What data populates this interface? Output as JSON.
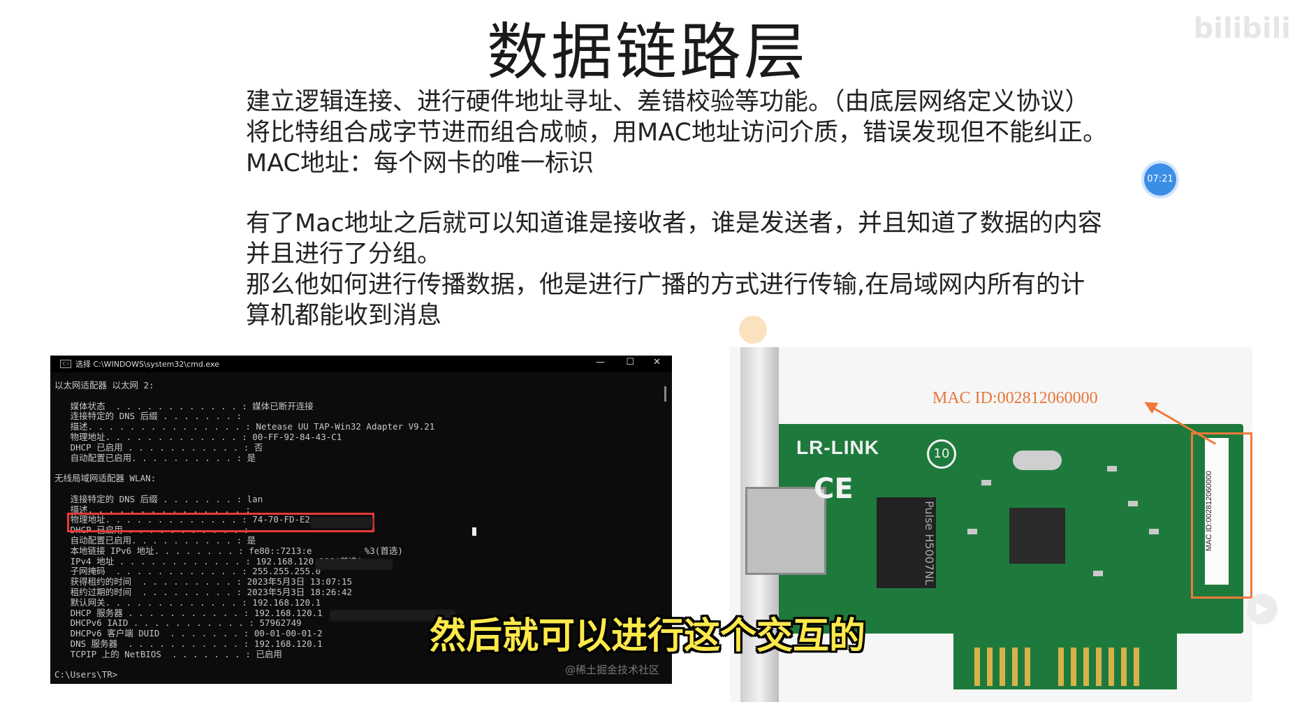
{
  "slide": {
    "title": "数据链路层",
    "paragraphs": [
      "建立逻辑连接、进行硬件地址寻址、差错校验等功能。（由底层网络定义协议）",
      "将比特组合成字节进而组合成帧，用MAC地址访问介质，错误发现但不能纠正。",
      "MAC地址：每个网卡的唯一标识",
      "有了Mac地址之后就可以知道谁是接收者，谁是发送者，并且知道了数据的内容",
      "并且进行了分组。",
      "那么他如何进行传播数据，他是进行广播的方式进行传输,在局域网内所有的计",
      "算机都能收到消息"
    ]
  },
  "video": {
    "timestamp": "07:21",
    "subtitle": "然后就可以进行这个交互的",
    "watermark_top": "bilibili"
  },
  "cmd": {
    "title": "选择 C:\\WINDOWS\\system32\\cmd.exe",
    "icon_text": "C:\\",
    "minimize": "—",
    "maximize": "☐",
    "close": "✕",
    "lines": [
      "以太网适配器 以太网 2:",
      "",
      "   媒体状态  . . . . . . . . . . . . : 媒体已断开连接",
      "   连接特定的 DNS 后缀 . . . . . . . :",
      "   描述. . . . . . . . . . . . . . . : Netease UU TAP-Win32 Adapter V9.21",
      "   物理地址. . . . . . . . . . . . . : 00-FF-92-84-43-C1",
      "   DHCP 已启用 . . . . . . . . . . . : 否",
      "   自动配置已启用. . . . . . . . . . : 是",
      "",
      "无线局域网适配器 WLAN:",
      "",
      "   连接特定的 DNS 后缀 . . . . . . . : lan",
      "   描述. . . . . . . . . . . . . . . :",
      "   物理地址. . . . . . . . . . . . . : 74-70-FD-E2-",
      "   DHCP 已启用 . . . . . . . . . . . :",
      "   自动配置已启用. . . . . . . . . . : 是",
      "   本地链接 IPv6 地址. . . . . . . . : fe80::7213:e          %3(首选)",
      "   IPv4 地址 . . . . . . . . . . . . : 192.168.120.128(首选)",
      "   子网掩码  . . . . . . . . . . . . : 255.255.255.0",
      "   获得租约的时间  . . . . . . . . . : 2023年5月3日 13:07:15",
      "   租约过期的时间  . . . . . . . . . : 2023年5月3日 18:26:42",
      "   默认网关. . . . . . . . . . . . . : 192.168.120.1",
      "   DHCP 服务器 . . . . . . . . . . . : 192.168.120.1",
      "   DHCPv6 IAID . . . . . . . . . . . : 57962749",
      "   DHCPv6 客户端 DUID  . . . . . . . : 00-01-00-01-2",
      "   DNS 服务器  . . . . . . . . . . . : 192.168.120.1",
      "   TCPIP 上的 NetBIOS  . . . . . . . : 已启用",
      "",
      "C:\\Users\\TR>"
    ],
    "watermark": "@稀土掘金技术社区"
  },
  "nic_photo": {
    "caption": "MAC ID:002812060000",
    "brand": "LR-LINK",
    "ce": "CE",
    "ten": "10",
    "chip_label": "Pulse H5007NL",
    "sticker": "MAC ID:002812060000"
  },
  "colors": {
    "highlight_red": "#e8383a",
    "arrow_orange": "#f07a3a",
    "subtitle_yellow": "#ffe94a",
    "badge_blue": "#3a8ee6"
  }
}
